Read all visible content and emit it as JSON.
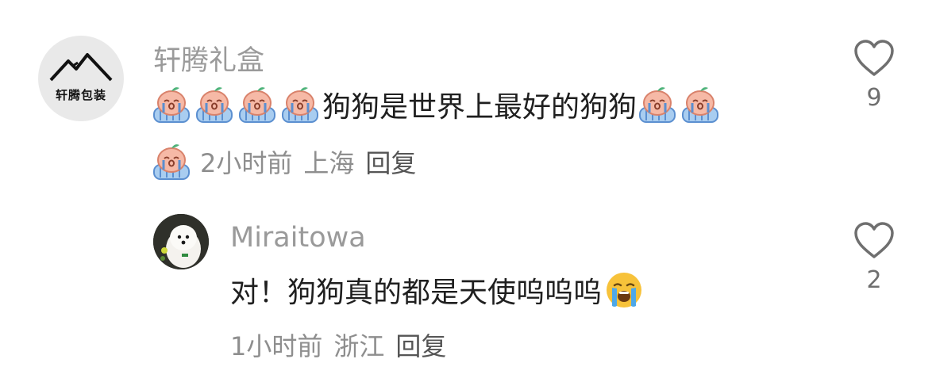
{
  "comments": [
    {
      "avatar_text": "轩腾包装",
      "username": "轩腾礼盒",
      "text": "狗狗是世界上最好的狗狗",
      "time": "2小时前",
      "location": "上海",
      "reply_label": "回复",
      "likes": "9",
      "leading_stickers": "crying-peach-sticker",
      "trailing_stickers": "crying-peach-sticker"
    },
    {
      "username": "Miraitowa",
      "text": "对！狗狗真的都是天使呜呜呜",
      "emoji": "loudly-crying-face",
      "time": "1小时前",
      "location": "浙江",
      "reply_label": "回复",
      "likes": "2"
    }
  ],
  "colors": {
    "username": "#9a9a9a",
    "meta": "#8e8e8e",
    "text": "#1f1f1f",
    "icon": "#6f6f6f"
  }
}
